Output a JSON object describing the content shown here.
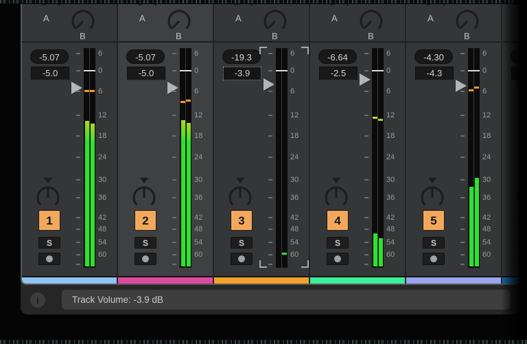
{
  "colors": {
    "meter_green": "#2ee22e",
    "peak_orange": "#f29b2a",
    "zero_marker": "#dedede",
    "number_button": "#f2a85c"
  },
  "send_row": {
    "send_a_label": "A",
    "send_b_label": "B"
  },
  "scale": {
    "ticks": [
      {
        "db": 6,
        "label": "6"
      },
      {
        "db": 0,
        "label": "0"
      },
      {
        "db": -6,
        "label": "6"
      },
      {
        "db": -12,
        "label": "12"
      },
      {
        "db": -18,
        "label": "18"
      },
      {
        "db": -24,
        "label": "24"
      },
      {
        "db": -30,
        "label": "30"
      },
      {
        "db": -36,
        "label": "36"
      },
      {
        "db": -42,
        "label": "42"
      },
      {
        "db": -48,
        "label": "48"
      },
      {
        "db": -54,
        "label": "54"
      },
      {
        "db": -60,
        "label": "60"
      },
      {
        "db": -66,
        "label": ""
      }
    ]
  },
  "tracks": [
    {
      "number_label": "1",
      "solo_label": "S",
      "peak_display": "-5.07",
      "volume_display": "-5.0",
      "fader_db": -5.0,
      "selected": false,
      "brackets": false,
      "editing": false,
      "meter": {
        "left_db": -13.6,
        "right_db": -14.4,
        "gradient_top": true
      },
      "peak_holds": [
        {
          "side": "left",
          "db": -5.8,
          "color": "#f29b2a"
        },
        {
          "side": "right",
          "db": -5.8,
          "color": "#f29b2a"
        }
      ],
      "color": "#8ec3f2"
    },
    {
      "number_label": "2",
      "solo_label": "S",
      "peak_display": "-5.07",
      "volume_display": "-5.0",
      "fader_db": -5.0,
      "selected": true,
      "brackets": false,
      "editing": false,
      "meter": {
        "left_db": -13.4,
        "right_db": -14.2,
        "gradient_top": true
      },
      "peak_holds": [
        {
          "side": "left",
          "db": -8.6,
          "color": "#f29b2a"
        },
        {
          "side": "right",
          "db": -8.3,
          "color": "#f29b2a"
        }
      ],
      "color": "#de4b9e"
    },
    {
      "number_label": "3",
      "solo_label": "S",
      "peak_display": "-19.3",
      "volume_display": "-3.9",
      "fader_db": -3.9,
      "selected": false,
      "brackets": true,
      "editing": true,
      "meter": {
        "left_db": null,
        "right_db": null,
        "gradient_top": false
      },
      "peak_holds": [
        {
          "side": "right",
          "db": -59.3,
          "color": "#2fe42f"
        }
      ],
      "color": "#f2a229"
    },
    {
      "number_label": "4",
      "solo_label": "S",
      "peak_display": "-6.64",
      "volume_display": "-2.5",
      "fader_db": -2.5,
      "selected": false,
      "brackets": false,
      "editing": false,
      "meter": {
        "left_db": -49.9,
        "right_db": -52.1,
        "gradient_top": false
      },
      "peak_holds": [
        {
          "side": "left",
          "db": -12.6,
          "color": "#ccd82b"
        },
        {
          "side": "right",
          "db": -13.2,
          "color": "#9ed42a"
        }
      ],
      "color": "#3bf09b"
    },
    {
      "number_label": "5",
      "solo_label": "S",
      "peak_display": "-4.30",
      "volume_display": "-4.3",
      "fader_db": -4.3,
      "selected": false,
      "brackets": false,
      "editing": false,
      "meter": {
        "left_db": -32.3,
        "right_db": -29.5,
        "gradient_top": false
      },
      "peak_holds": [
        {
          "side": "left",
          "db": -5.6,
          "color": "#f29b2a"
        },
        {
          "side": "right",
          "db": -4.7,
          "color": "#f29b2a"
        }
      ],
      "color": "#98a5ee"
    },
    {
      "number_label": "",
      "solo_label": "",
      "peak_display": "",
      "volume_display": "",
      "fader_db": null,
      "selected": false,
      "brackets": false,
      "editing": false,
      "partial": true,
      "meter": {
        "left_db": null,
        "right_db": null,
        "gradient_top": false
      },
      "peak_holds": [],
      "color": "#1a6db5"
    }
  ],
  "status_bar": {
    "text": "Track Volume: -3.9 dB"
  }
}
